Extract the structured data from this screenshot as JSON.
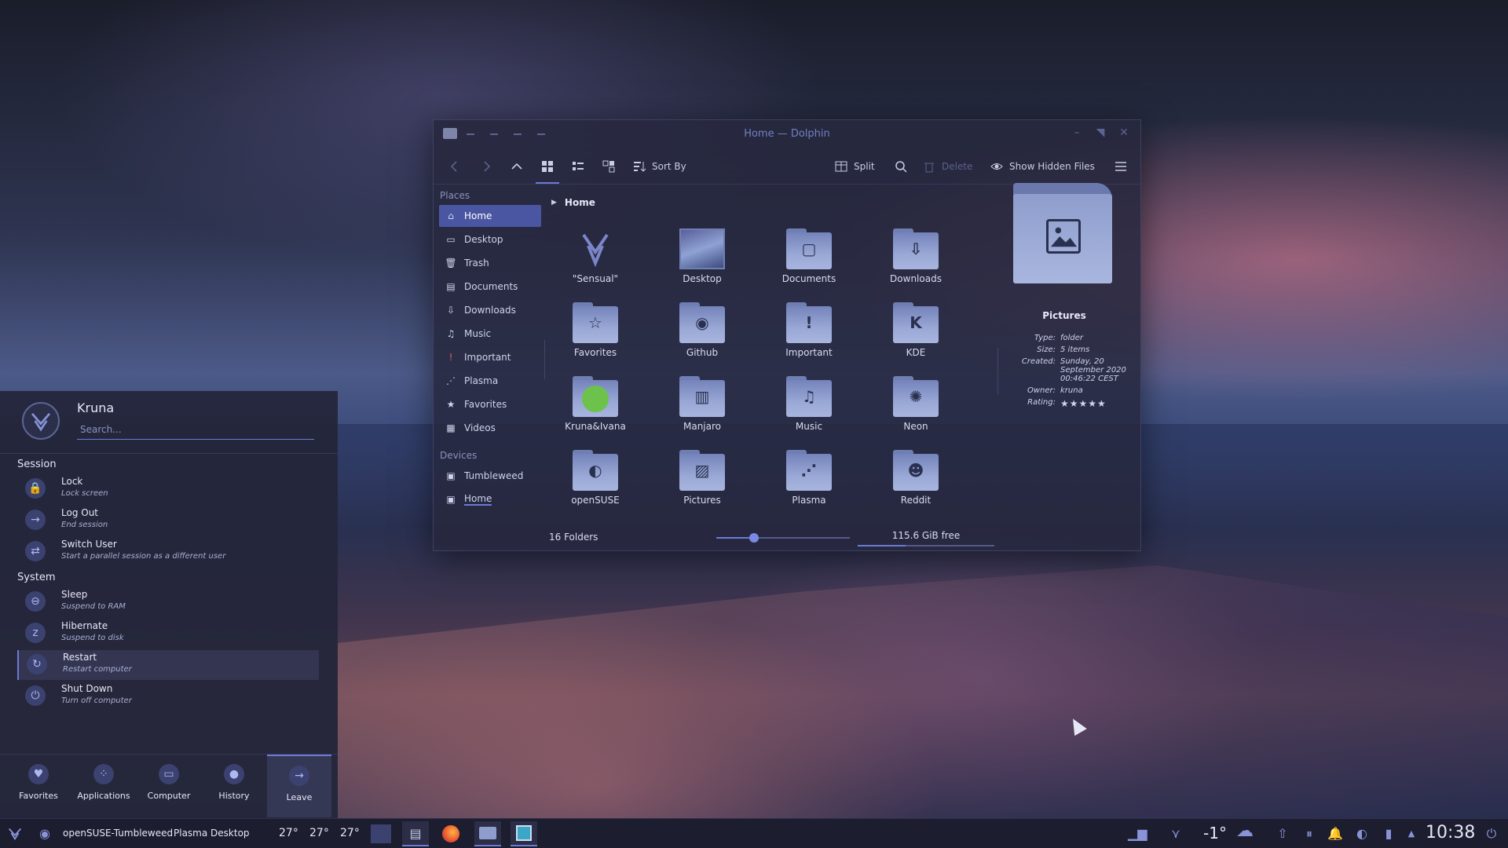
{
  "window": {
    "title": "Home — Dolphin",
    "toolbar": {
      "sort_by": "Sort By",
      "split": "Split",
      "delete": "Delete",
      "show_hidden": "Show Hidden Files"
    },
    "places_header": "Places",
    "places": [
      {
        "label": "Home",
        "icon": "home-icon"
      },
      {
        "label": "Desktop",
        "icon": "desktop-icon"
      },
      {
        "label": "Trash",
        "icon": "trash-icon"
      },
      {
        "label": "Documents",
        "icon": "documents-icon"
      },
      {
        "label": "Downloads",
        "icon": "downloads-icon"
      },
      {
        "label": "Music",
        "icon": "music-icon"
      },
      {
        "label": "Important",
        "icon": "important-icon"
      },
      {
        "label": "Plasma",
        "icon": "plasma-icon"
      },
      {
        "label": "Favorites",
        "icon": "star-icon"
      },
      {
        "label": "Videos",
        "icon": "videos-icon"
      }
    ],
    "devices_header": "Devices",
    "devices": [
      {
        "label": "Tumbleweed",
        "icon": "drive-icon"
      },
      {
        "label": "Home",
        "icon": "drive-icon"
      }
    ],
    "breadcrumb": "Home",
    "files": [
      {
        "label": "\"Sensual\"",
        "glyph": ""
      },
      {
        "label": "Desktop",
        "glyph": ""
      },
      {
        "label": "Documents",
        "glyph": "▢"
      },
      {
        "label": "Downloads",
        "glyph": "⇩"
      },
      {
        "label": "Favorites",
        "glyph": "☆"
      },
      {
        "label": "Github",
        "glyph": "◉"
      },
      {
        "label": "Important",
        "glyph": "!"
      },
      {
        "label": "KDE",
        "glyph": "K"
      },
      {
        "label": "Kruna&Ivana",
        "glyph": ""
      },
      {
        "label": "Manjaro",
        "glyph": "▥"
      },
      {
        "label": "Music",
        "glyph": "♫"
      },
      {
        "label": "Neon",
        "glyph": "✺"
      },
      {
        "label": "openSUSE",
        "glyph": "◐"
      },
      {
        "label": "Pictures",
        "glyph": "▨"
      },
      {
        "label": "Plasma",
        "glyph": "⋰"
      },
      {
        "label": "Reddit",
        "glyph": "☻"
      }
    ],
    "status": {
      "count": "16 Folders",
      "free": "115.6 GiB free",
      "zoom_fraction": 0.28,
      "used_fraction": 0.35
    },
    "info": {
      "name": "Pictures",
      "rows": [
        {
          "k": "Type:",
          "v": "folder"
        },
        {
          "k": "Size:",
          "v": "5 items"
        },
        {
          "k": "Created:",
          "v": "Sunday, 20 September 2020 00:46:22 CEST"
        },
        {
          "k": "Owner:",
          "v": "kruna"
        }
      ],
      "rating_label": "Rating:",
      "rating": "★★★★★"
    }
  },
  "launcher": {
    "user": "Kruna",
    "search_placeholder": "Search...",
    "session_header": "Session",
    "session": [
      {
        "title": "Lock",
        "sub": "Lock screen",
        "icon": "lock-icon",
        "glyph": "🔒"
      },
      {
        "title": "Log Out",
        "sub": "End session",
        "icon": "logout-icon",
        "glyph": "→"
      },
      {
        "title": "Switch User",
        "sub": "Start a parallel session as a different user",
        "icon": "switch-user-icon",
        "glyph": "⇄"
      }
    ],
    "system_header": "System",
    "system": [
      {
        "title": "Sleep",
        "sub": "Suspend to RAM",
        "icon": "sleep-icon",
        "glyph": "⊖"
      },
      {
        "title": "Hibernate",
        "sub": "Suspend to disk",
        "icon": "hibernate-icon",
        "glyph": "z"
      },
      {
        "title": "Restart",
        "sub": "Restart computer",
        "icon": "restart-icon",
        "glyph": "↻"
      },
      {
        "title": "Shut Down",
        "sub": "Turn off computer",
        "icon": "shutdown-icon",
        "glyph": "⏻"
      }
    ],
    "tabs": [
      {
        "label": "Favorites",
        "glyph": "♥"
      },
      {
        "label": "Applications",
        "glyph": "⁘"
      },
      {
        "label": "Computer",
        "glyph": "▭"
      },
      {
        "label": "History",
        "glyph": "●"
      },
      {
        "label": "Leave",
        "glyph": "→"
      }
    ]
  },
  "panel": {
    "activity": "openSUSE-Tumbleweed",
    "desktop": "Plasma Desktop",
    "temps": [
      "27°",
      "27°",
      "27°"
    ],
    "weather_temp": "-1°",
    "clock": "10:38"
  },
  "colors": {
    "accent": "#6b7ad6",
    "selection": "#4b56a3",
    "panel": "#1c1d2e"
  }
}
